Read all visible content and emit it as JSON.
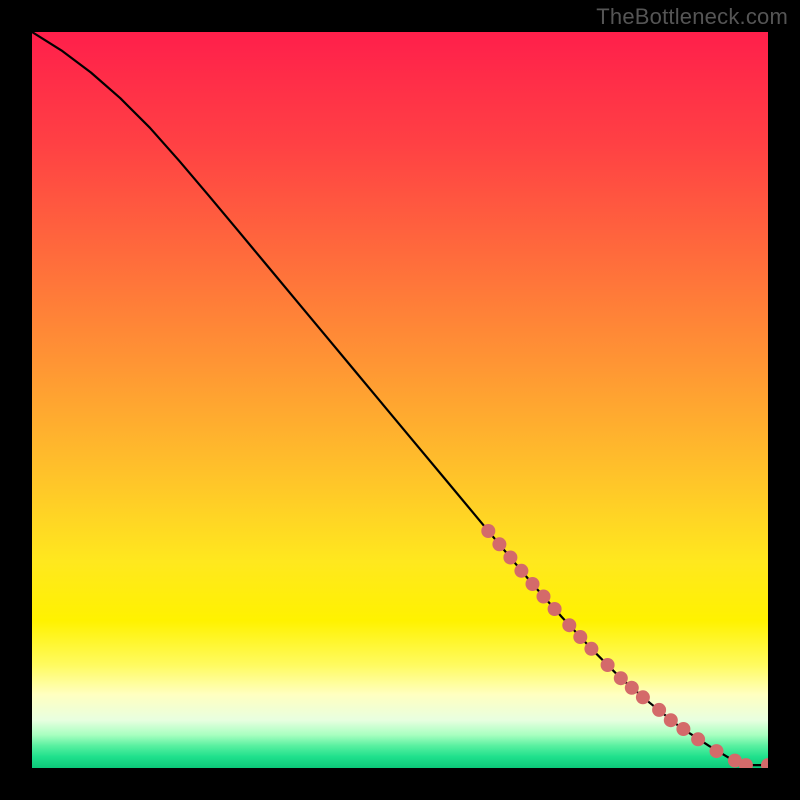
{
  "watermark": "TheBottleneck.com",
  "colors": {
    "dot": "#d46a6a",
    "curve": "#000000",
    "frame": "#000000",
    "gradient": [
      {
        "offset": 0.0,
        "color": "#ff1f4b"
      },
      {
        "offset": 0.15,
        "color": "#ff4044"
      },
      {
        "offset": 0.3,
        "color": "#ff6a3c"
      },
      {
        "offset": 0.45,
        "color": "#ff9534"
      },
      {
        "offset": 0.6,
        "color": "#ffc22a"
      },
      {
        "offset": 0.72,
        "color": "#ffe81e"
      },
      {
        "offset": 0.8,
        "color": "#fff200"
      },
      {
        "offset": 0.86,
        "color": "#fffb60"
      },
      {
        "offset": 0.9,
        "color": "#ffffc0"
      },
      {
        "offset": 0.935,
        "color": "#e8ffe0"
      },
      {
        "offset": 0.955,
        "color": "#a8ffc0"
      },
      {
        "offset": 0.97,
        "color": "#58f0a0"
      },
      {
        "offset": 0.985,
        "color": "#1fe08c"
      },
      {
        "offset": 1.0,
        "color": "#0cc879"
      }
    ]
  },
  "chart_data": {
    "type": "line",
    "title": "",
    "xlabel": "",
    "ylabel": "",
    "xlim": [
      0,
      1
    ],
    "ylim": [
      0,
      1
    ],
    "curve": [
      {
        "x": 0.0,
        "y": 1.0
      },
      {
        "x": 0.04,
        "y": 0.975
      },
      {
        "x": 0.08,
        "y": 0.945
      },
      {
        "x": 0.12,
        "y": 0.91
      },
      {
        "x": 0.16,
        "y": 0.87
      },
      {
        "x": 0.2,
        "y": 0.825
      },
      {
        "x": 0.24,
        "y": 0.778
      },
      {
        "x": 0.28,
        "y": 0.73
      },
      {
        "x": 0.32,
        "y": 0.682
      },
      {
        "x": 0.36,
        "y": 0.634
      },
      {
        "x": 0.4,
        "y": 0.586
      },
      {
        "x": 0.44,
        "y": 0.538
      },
      {
        "x": 0.48,
        "y": 0.49
      },
      {
        "x": 0.52,
        "y": 0.442
      },
      {
        "x": 0.56,
        "y": 0.394
      },
      {
        "x": 0.6,
        "y": 0.346
      },
      {
        "x": 0.64,
        "y": 0.298
      },
      {
        "x": 0.68,
        "y": 0.25
      },
      {
        "x": 0.72,
        "y": 0.205
      },
      {
        "x": 0.76,
        "y": 0.162
      },
      {
        "x": 0.8,
        "y": 0.122
      },
      {
        "x": 0.84,
        "y": 0.088
      },
      {
        "x": 0.88,
        "y": 0.056
      },
      {
        "x": 0.92,
        "y": 0.03
      },
      {
        "x": 0.95,
        "y": 0.012
      },
      {
        "x": 0.97,
        "y": 0.004
      },
      {
        "x": 1.0,
        "y": 0.004
      }
    ],
    "dots": [
      {
        "x": 0.62,
        "y": 0.322
      },
      {
        "x": 0.635,
        "y": 0.304
      },
      {
        "x": 0.65,
        "y": 0.286
      },
      {
        "x": 0.665,
        "y": 0.268
      },
      {
        "x": 0.68,
        "y": 0.25
      },
      {
        "x": 0.695,
        "y": 0.233
      },
      {
        "x": 0.71,
        "y": 0.216
      },
      {
        "x": 0.73,
        "y": 0.194
      },
      {
        "x": 0.745,
        "y": 0.178
      },
      {
        "x": 0.76,
        "y": 0.162
      },
      {
        "x": 0.782,
        "y": 0.14
      },
      {
        "x": 0.8,
        "y": 0.122
      },
      {
        "x": 0.815,
        "y": 0.109
      },
      {
        "x": 0.83,
        "y": 0.096
      },
      {
        "x": 0.852,
        "y": 0.079
      },
      {
        "x": 0.868,
        "y": 0.065
      },
      {
        "x": 0.885,
        "y": 0.053
      },
      {
        "x": 0.905,
        "y": 0.039
      },
      {
        "x": 0.93,
        "y": 0.023
      },
      {
        "x": 0.955,
        "y": 0.01
      },
      {
        "x": 0.97,
        "y": 0.004
      },
      {
        "x": 1.0,
        "y": 0.004
      }
    ]
  }
}
